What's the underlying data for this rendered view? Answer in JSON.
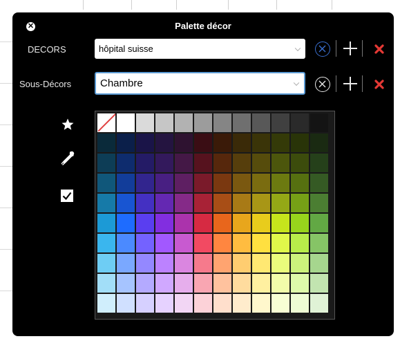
{
  "dialog": {
    "title": "Palette décor"
  },
  "decors": {
    "label": "DECORS",
    "value": "hôpital suisse"
  },
  "sous_decors": {
    "label": "Sous-Décors",
    "value": "Chambre"
  },
  "tools": {
    "icons": [
      "star-icon",
      "eyedropper-icon",
      "checkbox-checked-icon"
    ]
  },
  "colors": {
    "accent": "#3a6fd0",
    "delete": "#e53935",
    "background": "#000000"
  },
  "palette": {
    "rows": [
      [
        "none",
        "#ffffff",
        "#dadada",
        "#c6c6c6",
        "#b2b2b2",
        "#9c9c9c",
        "#858585",
        "#6f6f6f",
        "#585858",
        "#404040",
        "#2a2a2a",
        "#141414"
      ],
      [
        "#0a2a3a",
        "#0b1f4a",
        "#1a1448",
        "#241440",
        "#2e1230",
        "#3a0d14",
        "#3a1a08",
        "#3a2a08",
        "#3a3408",
        "#343a08",
        "#293408",
        "#1a2a12"
      ],
      [
        "#0d3d56",
        "#0e2c6e",
        "#241b66",
        "#33195c",
        "#441846",
        "#56121e",
        "#56270c",
        "#563e0c",
        "#564c0c",
        "#4c560c",
        "#3c4c0c",
        "#25401a"
      ],
      [
        "#10577a",
        "#123d9a",
        "#32258e",
        "#481f82",
        "#5e1f62",
        "#7a1a2a",
        "#7a3810",
        "#7a5810",
        "#7a6c10",
        "#6c7a10",
        "#567010",
        "#355a24"
      ],
      [
        "#167aa8",
        "#1855d2",
        "#4430c2",
        "#6428b2",
        "#852a88",
        "#a82236",
        "#a84e16",
        "#a87a16",
        "#a89616",
        "#94a816",
        "#76a016",
        "#4b7e32"
      ],
      [
        "#1c9ad6",
        "#1e6cff",
        "#5a3ef0",
        "#822ee0",
        "#ab33ac",
        "#d62a42",
        "#e8661c",
        "#e8a61c",
        "#e8cc1c",
        "#c6e41c",
        "#98d41c",
        "#62a844"
      ],
      [
        "#3ab6ee",
        "#4b8aff",
        "#7462ff",
        "#a258ff",
        "#c85ad0",
        "#f24a62",
        "#ff8640",
        "#ffbc40",
        "#ffe040",
        "#e0f84a",
        "#b8ec4a",
        "#86c466"
      ],
      [
        "#6ecdf4",
        "#7aa8ff",
        "#9488ff",
        "#bc82ff",
        "#da86e0",
        "#f67a8c",
        "#ffa470",
        "#ffcd70",
        "#ffe872",
        "#eafc7c",
        "#ccf27c",
        "#a6d68e"
      ],
      [
        "#a2def8",
        "#a6c4ff",
        "#b4aaff",
        "#d0a8ff",
        "#e6aeec",
        "#f9a6b2",
        "#ffc29e",
        "#ffdc9e",
        "#fff0a0",
        "#f2fcaa",
        "#defaaa",
        "#c2e4b0"
      ],
      [
        "#d0eefc",
        "#d0e0ff",
        "#d6d0ff",
        "#e6d2ff",
        "#f2d6f4",
        "#fcd2d8",
        "#ffdfcc",
        "#ffeccc",
        "#fff7cc",
        "#f8fed4",
        "#eefcd4",
        "#e0f2d6"
      ]
    ]
  }
}
